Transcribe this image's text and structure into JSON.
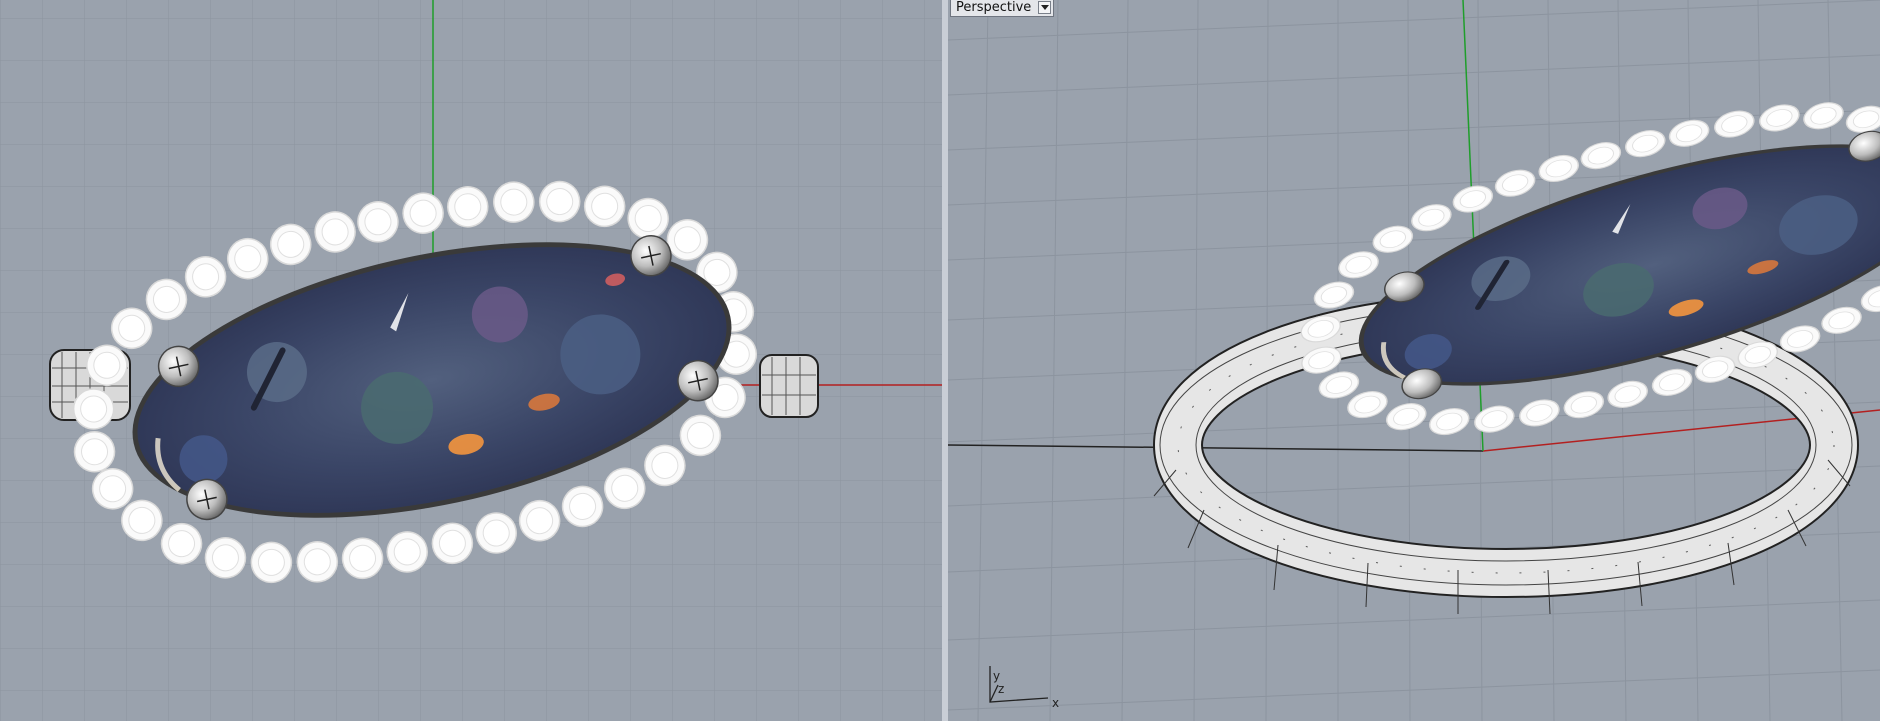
{
  "viewports": {
    "left": {
      "name": ""
    },
    "right": {
      "name": "Perspective",
      "axis_labels": {
        "x": "x",
        "y": "y",
        "z": "z"
      }
    }
  },
  "colors": {
    "viewport_background": "#9aa2ad",
    "grid_line": "#8c949f",
    "x_axis": "#b32020",
    "y_axis": "#1f9e2b",
    "gemstone_base": "#3e4a6e",
    "halo_stone": "#ffffff",
    "prong_metal": "#c8c8c8",
    "band_metal": "#e6e6e6"
  },
  "icons": [
    "viewport-menu-arrow-icon",
    "axis-gizmo-icon"
  ]
}
